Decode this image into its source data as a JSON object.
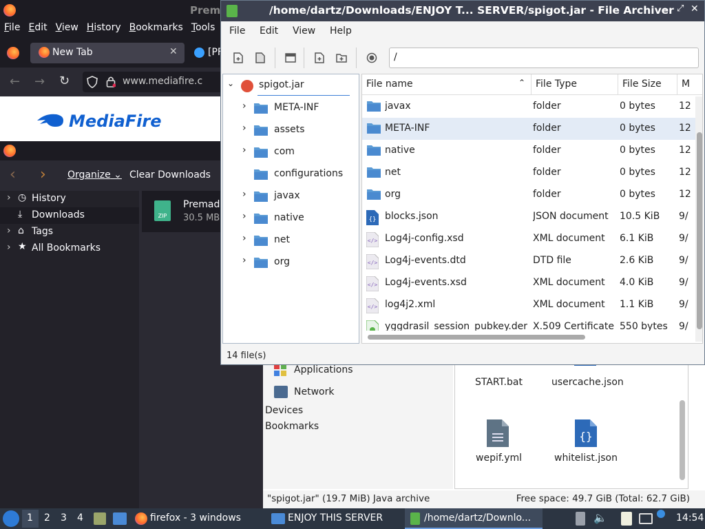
{
  "firefox": {
    "title": "Prem",
    "menu": [
      "File",
      "Edit",
      "View",
      "History",
      "Bookmarks",
      "Tools"
    ],
    "tabs": [
      {
        "label": "New Tab"
      },
      {
        "label": "[PF"
      }
    ],
    "url": "www.mediafire.c",
    "site_logo": "MediaFire"
  },
  "library": {
    "toolbar": {
      "organize": "Organize",
      "clear": "Clear Downloads"
    },
    "tree": [
      {
        "label": "History",
        "icon": "clock-icon"
      },
      {
        "label": "Downloads",
        "icon": "download-icon"
      },
      {
        "label": "Tags",
        "icon": "tag-icon"
      },
      {
        "label": "All Bookmarks",
        "icon": "star-icon"
      }
    ],
    "download": {
      "name": "Premade",
      "size": "30.5 MB"
    }
  },
  "archiver": {
    "title": "/home/dartz/Downloads/ENJOY T... SERVER/spigot.jar - File Archiver",
    "menu": [
      "File",
      "Edit",
      "View",
      "Help"
    ],
    "path": "/",
    "tree_root": "spigot.jar",
    "tree": [
      "META-INF",
      "assets",
      "com",
      "configurations",
      "javax",
      "native",
      "net",
      "org"
    ],
    "tree_expandable": [
      true,
      true,
      true,
      false,
      true,
      true,
      true,
      true
    ],
    "columns": {
      "name": "File name",
      "type": "File Type",
      "size": "File Size",
      "modified": "M"
    },
    "files": [
      {
        "name": "javax",
        "type": "folder",
        "size": "0 bytes",
        "mod": "12",
        "icon": "folder"
      },
      {
        "name": "META-INF",
        "type": "folder",
        "size": "0 bytes",
        "mod": "12",
        "icon": "folder"
      },
      {
        "name": "native",
        "type": "folder",
        "size": "0 bytes",
        "mod": "12",
        "icon": "folder"
      },
      {
        "name": "net",
        "type": "folder",
        "size": "0 bytes",
        "mod": "12",
        "icon": "folder"
      },
      {
        "name": "org",
        "type": "folder",
        "size": "0 bytes",
        "mod": "12",
        "icon": "folder"
      },
      {
        "name": "blocks.json",
        "type": "JSON document",
        "size": "10.5 KiB",
        "mod": "9/",
        "icon": "json"
      },
      {
        "name": "Log4j-config.xsd",
        "type": "XML document",
        "size": "6.1 KiB",
        "mod": "9/",
        "icon": "xml"
      },
      {
        "name": "Log4j-events.dtd",
        "type": "DTD file",
        "size": "2.6 KiB",
        "mod": "9/",
        "icon": "xml"
      },
      {
        "name": "Log4j-events.xsd",
        "type": "XML document",
        "size": "4.0 KiB",
        "mod": "9/",
        "icon": "xml"
      },
      {
        "name": "log4j2.xml",
        "type": "XML document",
        "size": "1.1 KiB",
        "mod": "9/",
        "icon": "xml"
      },
      {
        "name": "yggdrasil_session_pubkey.der",
        "type": "X.509 Certificate",
        "size": "550 bytes",
        "mod": "9/",
        "icon": "cert"
      }
    ],
    "selected_index": 1,
    "status": "14 file(s)"
  },
  "filemanager": {
    "places": [
      {
        "label": "Applications"
      },
      {
        "label": "Network"
      }
    ],
    "sections": [
      "Devices",
      "Bookmarks"
    ],
    "icons": [
      {
        "label": "START.bat"
      },
      {
        "label": "usercache.json"
      },
      {
        "label": "wepif.yml"
      },
      {
        "label": "whitelist.json"
      }
    ],
    "status_left": "\"spigot.jar\" (19.7 MiB) Java archive",
    "status_right": "Free space: 49.7 GiB (Total: 62.7 GiB)"
  },
  "taskbar": {
    "workspaces": [
      "1",
      "2",
      "3",
      "4"
    ],
    "apps": [
      {
        "label": "firefox - 3 windows"
      },
      {
        "label": "ENJOY THIS SERVER"
      },
      {
        "label": "/home/dartz/Downlo..."
      }
    ],
    "clock": "14:54"
  },
  "colors": {
    "accent": "#3d7fd6",
    "folder": "#5b9bd5",
    "selection": "#e3ebf6",
    "taskbar": "#2c3542"
  }
}
